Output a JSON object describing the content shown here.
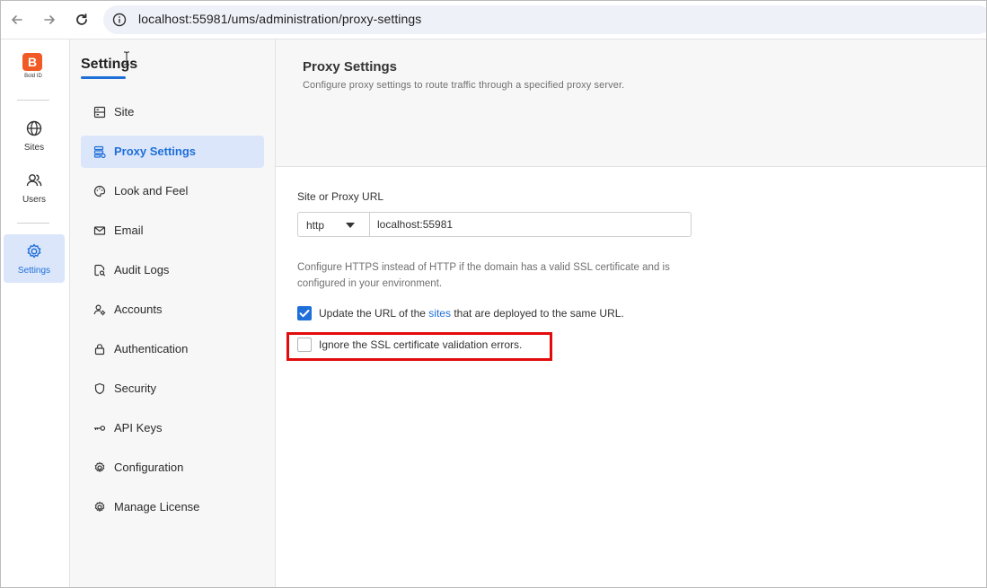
{
  "browser": {
    "url": "localhost:55981/ums/administration/proxy-settings"
  },
  "rail": {
    "logo_letter": "B",
    "logo_caption": "Bold ID",
    "items": [
      {
        "label": "Sites",
        "icon": "globe-icon"
      },
      {
        "label": "Users",
        "icon": "users-icon"
      },
      {
        "label": "Settings",
        "icon": "gear-icon",
        "active": true
      }
    ]
  },
  "sidebar": {
    "title": "Settings",
    "items": [
      {
        "label": "Site",
        "icon": "server-icon"
      },
      {
        "label": "Proxy Settings",
        "icon": "proxy-icon",
        "active": true
      },
      {
        "label": "Look and Feel",
        "icon": "palette-icon"
      },
      {
        "label": "Email",
        "icon": "mail-icon"
      },
      {
        "label": "Audit Logs",
        "icon": "audit-icon"
      },
      {
        "label": "Accounts",
        "icon": "accounts-icon"
      },
      {
        "label": "Authentication",
        "icon": "lock-icon"
      },
      {
        "label": "Security",
        "icon": "shield-icon"
      },
      {
        "label": "API Keys",
        "icon": "key-icon"
      },
      {
        "label": "Configuration",
        "icon": "gear-icon"
      },
      {
        "label": "Manage License",
        "icon": "gear-icon"
      }
    ]
  },
  "main": {
    "title": "Proxy Settings",
    "subtitle": "Configure proxy settings to route traffic through a specified proxy server.",
    "field_label": "Site or Proxy URL",
    "protocol": "http",
    "url_value": "localhost:55981",
    "hint": "Configure HTTPS instead of HTTP if the domain has a valid SSL certificate and is configured in your environment.",
    "update_url": {
      "before": "Update the URL of the ",
      "link": "sites",
      "after": " that are deployed to the same URL.",
      "checked": true
    },
    "ignore_ssl": {
      "label": "Ignore the SSL certificate validation errors.",
      "checked": false
    }
  },
  "colors": {
    "accent": "#1f6fd8",
    "brand": "#f15a24",
    "highlight": "#e30b0b",
    "active_bg": "#dbe6fb"
  }
}
